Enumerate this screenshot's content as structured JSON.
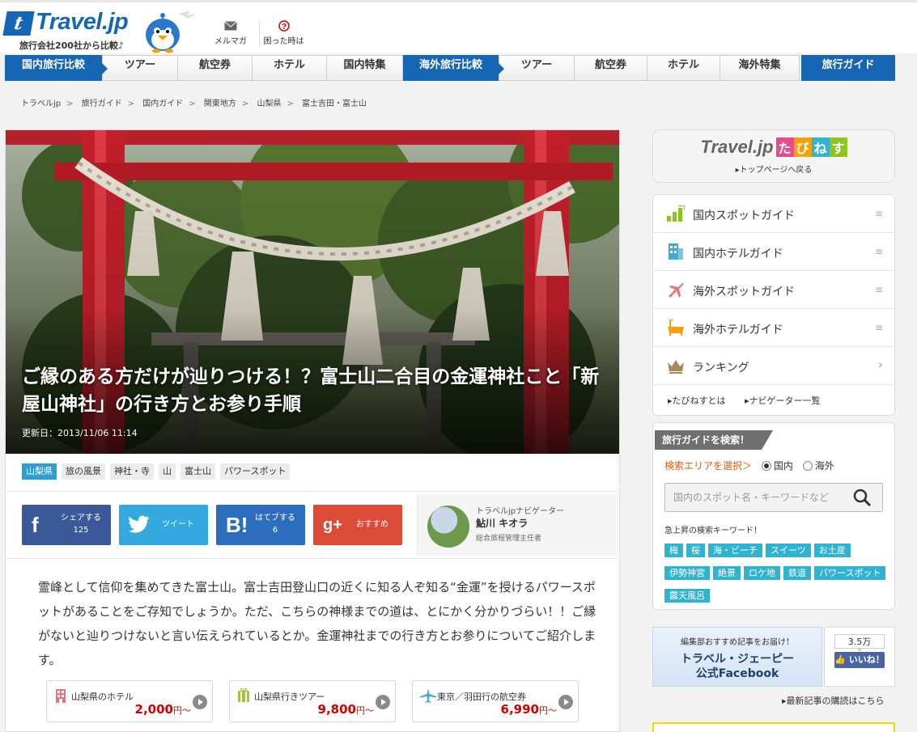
{
  "header": {
    "logo_text": "Travel.jp",
    "logo_letter": "t",
    "tagline": "旅行会社200社から比較♪",
    "mail_label": "メルマガ",
    "help_label": "困った時は"
  },
  "nav": {
    "items": [
      {
        "label": "国内旅行比較",
        "primary": true
      },
      {
        "label": "ツアー"
      },
      {
        "label": "航空券"
      },
      {
        "label": "ホテル"
      },
      {
        "label": "国内特集"
      },
      {
        "label": "海外旅行比較",
        "primary": true
      },
      {
        "label": "ツアー"
      },
      {
        "label": "航空券"
      },
      {
        "label": "ホテル"
      },
      {
        "label": "海外特集"
      },
      {
        "label": "旅行ガイド",
        "last": true
      }
    ]
  },
  "breadcrumb": [
    "トラベルjp",
    "旅行ガイド",
    "国内ガイド",
    "関東地方",
    "山梨県",
    "富士吉田・富士山"
  ],
  "article": {
    "title": "ご縁のある方だけが辿りつける！？富士山二合目の金運神社こと「新屋山神社」の行き方とお参り手順",
    "updated": "更新日：2013/11/06 11:14",
    "tags": [
      "山梨県",
      "旅の風景",
      "神社・寺",
      "山",
      "富士山",
      "パワースポット"
    ],
    "share": {
      "facebook": {
        "label": "シェアする",
        "count": "125"
      },
      "twitter": {
        "label": "ツイート"
      },
      "hatena": {
        "label": "はてブする",
        "count": "6"
      },
      "google": {
        "label": "おすすめ"
      }
    },
    "navigator": {
      "role": "トラベルjpナビゲーター",
      "name": "鮎川 キオラ",
      "title": "総合旅程管理主任者"
    },
    "lead": "霊峰として信仰を集めてきた富士山。富士吉田登山口の近くに知る人ぞ知る“金運”を授けるパワースポットがあることをご存知でしょうか。ただ、こちらの神様までの道は、とにかく分かりづらい！！ご縁がないと辿りつけないと言い伝えられているとか。金運神社までの行き方とお参りについてご紹介します。",
    "price_cards": [
      {
        "label": "山梨県のホテル",
        "price": "2,000",
        "unit": "円〜",
        "icon": "building-icon",
        "color": "#e2787a"
      },
      {
        "label": "山梨県行きツアー",
        "price": "9,800",
        "unit": "円〜",
        "icon": "luggage-icon",
        "color": "#a4c43b"
      },
      {
        "label": "東京／羽田行の航空券",
        "price": "6,990",
        "unit": "円〜",
        "icon": "plane-icon",
        "color": "#48a9cf"
      }
    ]
  },
  "sidebar": {
    "logo_text": "Travel.jp",
    "logo_hira": [
      "た",
      "び",
      "ね",
      "す"
    ],
    "logo_hira_colors": [
      "#e84a8e",
      "#f5a100",
      "#33b3d4",
      "#8fc31f"
    ],
    "back_link": "トップページへ戻る",
    "menu": [
      {
        "label": "国内スポットガイド",
        "icon": "bar-chart-icon",
        "color": "#8fc31f",
        "handle": "≡"
      },
      {
        "label": "国内ホテルガイド",
        "icon": "building-icon",
        "color": "#48a9cf",
        "handle": "≡"
      },
      {
        "label": "海外スポットガイド",
        "icon": "plane-icon",
        "color": "#e2787a",
        "handle": "≡"
      },
      {
        "label": "海外ホテルガイド",
        "icon": "bathtub-icon",
        "color": "#f5a100",
        "handle": "≡"
      },
      {
        "label": "ランキング",
        "icon": "crown-icon",
        "color": "#a68a5a",
        "handle": "›"
      }
    ],
    "links": [
      "たびねすとは",
      "ナビゲーター一覧"
    ],
    "search": {
      "heading": "旅行ガイドを検索！",
      "area_label": "検索エリアを選択＞",
      "options": [
        "国内",
        "海外"
      ],
      "selected": "国内",
      "placeholder": "国内のスポット名・キーワードなど",
      "keyword_heading": "急上昇の検索キーワード！",
      "keywords": [
        "梅",
        "桜",
        "海・ビーチ",
        "スイーツ",
        "お土産",
        "伊勢神宮",
        "絶景",
        "ロケ地",
        "鉄道",
        "パワースポット",
        "露天風呂"
      ]
    },
    "facebook": {
      "pre": "編集部おすすめ記事をお届け！",
      "main_line1": "トラベル・ジェーピー",
      "main_line2": "公式Facebook",
      "count": "3.5万",
      "like": "いいね！",
      "subscribe": "最新記事の購読はこちら"
    }
  }
}
